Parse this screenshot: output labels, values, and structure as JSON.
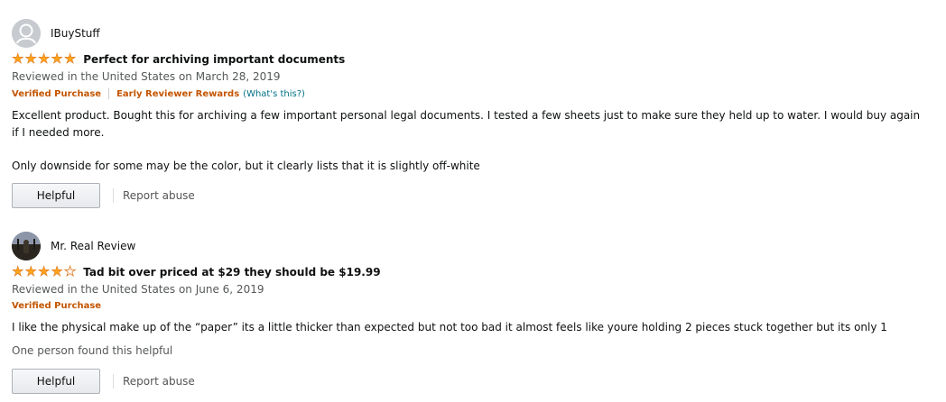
{
  "reviews": [
    {
      "author": "IBuyStuff",
      "rating": 5,
      "title": "Perfect for archiving important documents",
      "date": "Reviewed in the United States on March 28, 2019",
      "verified": "Verified Purchase",
      "early_reviewer": "Early Reviewer Rewards",
      "whats_this": "(What's this?)",
      "body_p1": "Excellent product. Bought this for archiving a few important personal legal documents. I tested a few sheets just to make sure they held up to water. I would buy again if I needed more.",
      "body_p2": "Only downside for some may be the color, but it clearly lists that it is slightly off-white",
      "helpful_label": "Helpful",
      "report_label": "Report abuse"
    },
    {
      "author": "Mr. Real Review",
      "rating": 4,
      "title": "Tad bit over priced at $29 they should be $19.99",
      "date": "Reviewed in the United States on June 6, 2019",
      "verified": "Verified Purchase",
      "body_p1": "I like the physical make up of the “paper” its a little thicker than expected but not too bad it almost feels like youre holding 2 pieces stuck together but its only 1",
      "helpful_count": "One person found this helpful",
      "helpful_label": "Helpful",
      "report_label": "Report abuse"
    }
  ],
  "colors": {
    "star": "#ffa41c",
    "badge": "#c45500",
    "link": "#007185"
  }
}
